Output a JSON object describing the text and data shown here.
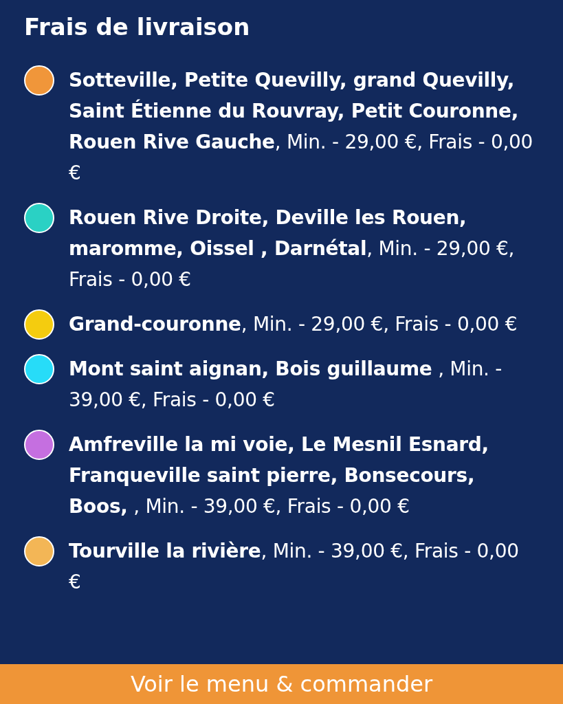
{
  "title": "Frais de livraison",
  "zones": [
    {
      "color": "#f0963a",
      "text": "**Sotteville, Petite Quevilly, grand Quevilly, Saint Étienne du Rouvray, Petit Couronne, Rouen Rive Gauche**, Min. - 29,00 €, Frais - 0,00 €"
    },
    {
      "color": "#2ad1c4",
      "text": "**Rouen Rive Droite, Deville les Rouen, maromme, Oissel , Darnétal**, Min. - 29,00 €, Frais - 0,00 €"
    },
    {
      "color": "#f4cc0f",
      "text": "**Grand-couronne**, Min. - 29,00 €, Frais - 0,00 €"
    },
    {
      "color": "#27dcf8",
      "text": "**Mont saint aignan, Bois guillaume** , Min. - 39,00 €, Frais - 0,00 €"
    },
    {
      "color": "#c56fe0",
      "text": "**Amfreville la mi voie, Le Mesnil Esnard, Franqueville saint pierre, Bonsecours, Boos,** , Min. - 39,00 €, Frais - 0,00 €"
    },
    {
      "color": "#f3b656",
      "text": "**Tourville la rivière**, Min. - 39,00 €, Frais - 0,00 €"
    }
  ],
  "button": "Voir le menu & commander"
}
